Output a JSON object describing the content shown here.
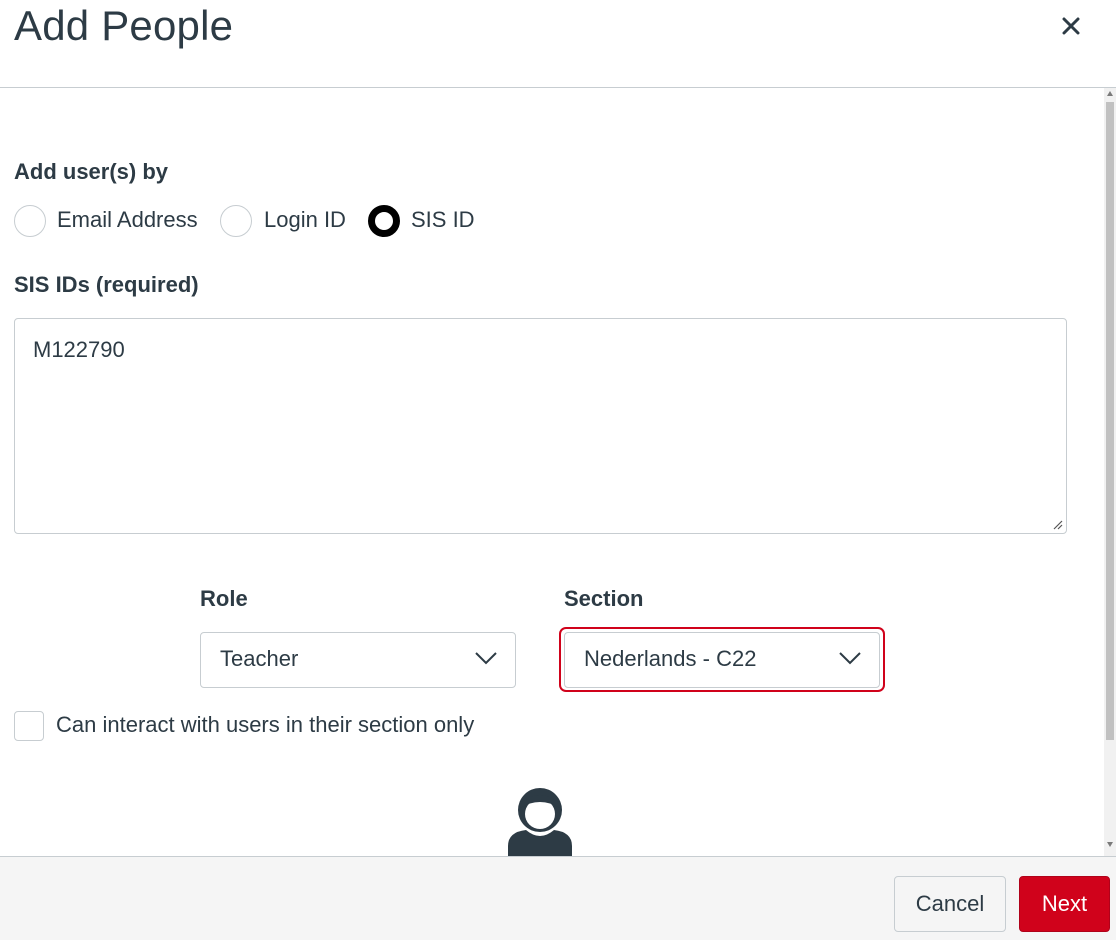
{
  "header": {
    "title": "Add People",
    "close_icon": "close-icon"
  },
  "form": {
    "add_by_label": "Add user(s) by",
    "add_by_options": [
      {
        "label": "Email Address",
        "checked": false
      },
      {
        "label": "Login ID",
        "checked": false
      },
      {
        "label": "SIS ID",
        "checked": true
      }
    ],
    "ids_label": "SIS IDs (required)",
    "ids_value": "M122790",
    "role_label": "Role",
    "role_value": "Teacher",
    "section_label": "Section",
    "section_value": "Nederlands - C22",
    "limit_checkbox_label": "Can interact with users in their section only",
    "limit_checkbox_checked": false
  },
  "footer": {
    "cancel_label": "Cancel",
    "next_label": "Next"
  },
  "colors": {
    "text": "#2d3b45",
    "border": "#c7cdd1",
    "primary": "#d0021b",
    "footer_bg": "#f5f5f5"
  }
}
